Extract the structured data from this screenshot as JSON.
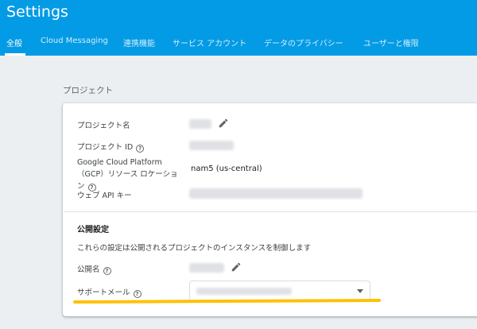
{
  "header": {
    "title": "Settings",
    "tabs": [
      {
        "label": "全般",
        "active": true
      },
      {
        "label": "Cloud Messaging"
      },
      {
        "label": "連携機能"
      },
      {
        "label": "サービス アカウント"
      },
      {
        "label": "データのプライバシー"
      },
      {
        "label": "ユーザーと権限"
      }
    ]
  },
  "project": {
    "section_title": "プロジェクト",
    "name_label": "プロジェクト名",
    "id_label": "プロジェクト ID",
    "location_label": "Google Cloud Platform（GCP）リソース ロケーション",
    "location_value": "nam5 (us-central)",
    "api_key_label": "ウェブ API キー"
  },
  "public": {
    "heading": "公開設定",
    "description": "これらの設定は公開されるプロジェクトのインスタンスを制御します",
    "name_label": "公開名",
    "support_email_label": "サポートメール"
  },
  "colors": {
    "header": "#039be5",
    "highlight": "#ffc107"
  }
}
